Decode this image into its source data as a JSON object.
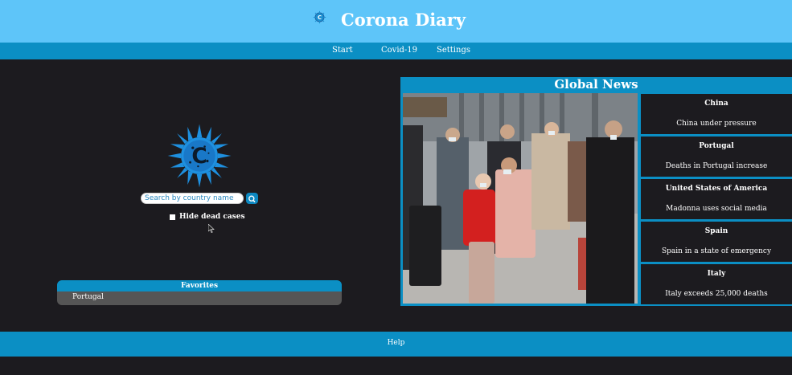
{
  "header": {
    "title": "Corona Diary",
    "logo_icon": "virus-icon"
  },
  "nav": {
    "items": [
      {
        "label": "Start"
      },
      {
        "label": "Covid-19"
      },
      {
        "label": "Settings"
      }
    ]
  },
  "search": {
    "placeholder": "Search by country name",
    "button_icon": "search-icon"
  },
  "filter": {
    "hide_dead_label": "Hide dead cases",
    "checked": false
  },
  "favorites": {
    "title": "Favorites",
    "items": [
      "Portugal"
    ]
  },
  "news": {
    "title": "Global News",
    "items": [
      {
        "country": "China",
        "headline": "China under pressure"
      },
      {
        "country": "Portugal",
        "headline": "Deaths in Portugal increase"
      },
      {
        "country": "United States of America",
        "headline": "Madonna uses social media"
      },
      {
        "country": "Spain",
        "headline": "Spain in a state of emergency"
      },
      {
        "country": "Italy",
        "headline": "Italy exceeds 25,000 deaths"
      }
    ]
  },
  "footer": {
    "help_label": "Help"
  },
  "colors": {
    "header_bg": "#5ec5f9",
    "accent": "#0b8fc4",
    "page_bg": "#1c1b1f"
  }
}
